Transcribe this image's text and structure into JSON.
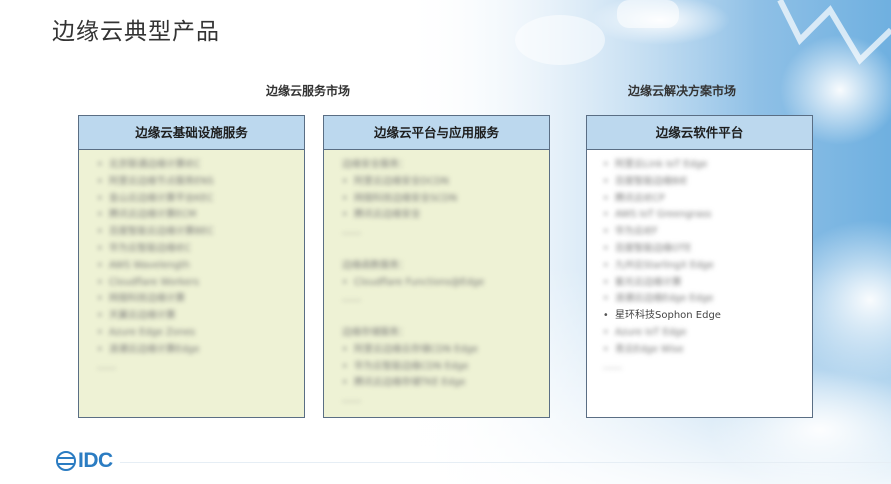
{
  "title": "边缘云典型产品",
  "markets": {
    "service": "边缘云服务市场",
    "solution": "边缘云解决方案市场"
  },
  "panels": [
    {
      "header": "边缘云基础设施服务",
      "rows": [
        {
          "text": "北京联通边缘计算IEC",
          "blur": true
        },
        {
          "text": "阿里云边缘节点服务ENS",
          "blur": true
        },
        {
          "text": "金山云边缘计算平台KEC",
          "blur": true
        },
        {
          "text": "腾讯云边缘计算ECM",
          "blur": true
        },
        {
          "text": "百度智能云边缘计算BEC",
          "blur": true
        },
        {
          "text": "华为云智能边缘IEC",
          "blur": true
        },
        {
          "text": "AWS Wavelength",
          "blur": true
        },
        {
          "text": "Cloudflare Workers",
          "blur": true
        },
        {
          "text": "网宿科技边缘计算",
          "blur": true
        },
        {
          "text": "天翼云边缘计算",
          "blur": true
        },
        {
          "text": "Azure Edge Zones",
          "blur": true
        },
        {
          "text": "浪潮云边缘计算Edge",
          "blur": true
        },
        {
          "text": "……",
          "blur": true,
          "bullet": false
        }
      ]
    },
    {
      "header": "边缘云平台与应用服务",
      "rows": [
        {
          "text": "边缘安全服务：",
          "blur": true,
          "bullet": false
        },
        {
          "text": "阿里云边缘安全DCDN",
          "blur": true
        },
        {
          "text": "网宿科技边缘安全SCDN",
          "blur": true
        },
        {
          "text": "腾讯云边缘安全",
          "blur": true
        },
        {
          "text": "……",
          "blur": true,
          "bullet": false
        },
        {
          "text": "",
          "blur": true,
          "bullet": false
        },
        {
          "text": "边缘函数服务：",
          "blur": true,
          "bullet": false
        },
        {
          "text": "Cloudflare Functions@Edge",
          "blur": true
        },
        {
          "text": "……",
          "blur": true,
          "bullet": false
        },
        {
          "text": "",
          "blur": true,
          "bullet": false
        },
        {
          "text": "边缘存储服务：",
          "blur": true,
          "bullet": false
        },
        {
          "text": "阿里云边缘云存储CDN Edge",
          "blur": true
        },
        {
          "text": "华为云智能边缘CDN Edge",
          "blur": true
        },
        {
          "text": "腾讯云边缘存储TKE Edge",
          "blur": true
        },
        {
          "text": "……",
          "blur": true,
          "bullet": false
        }
      ]
    },
    {
      "header": "边缘云软件平台",
      "rows": [
        {
          "text": "阿里云Link IoT Edge",
          "blur": true
        },
        {
          "text": "百度智能边缘BIE",
          "blur": true
        },
        {
          "text": "腾讯云IECP",
          "blur": true
        },
        {
          "text": "AWS IoT Greengrass",
          "blur": true
        },
        {
          "text": "华为云IEF",
          "blur": true
        },
        {
          "text": "百度智能边缘OTE",
          "blur": true
        },
        {
          "text": "九州云StarlingX Edge",
          "blur": true
        },
        {
          "text": "紫光云边缘计算",
          "blur": true
        },
        {
          "text": "浪潮云边缘Edge Edge",
          "blur": true
        },
        {
          "text": "星环科技Sophon Edge",
          "blur": false
        },
        {
          "text": "Azure IoT Edge",
          "blur": true
        },
        {
          "text": "青云Edge Wise",
          "blur": true
        },
        {
          "text": "……",
          "blur": true,
          "bullet": false
        }
      ]
    }
  ],
  "logo": {
    "text": "IDC"
  },
  "colors": {
    "panel_header": "#bcd8ee",
    "panel_fill_green": "#eef2d5",
    "panel_border": "#5a6e84",
    "logo_blue": "#2b7cc2"
  }
}
